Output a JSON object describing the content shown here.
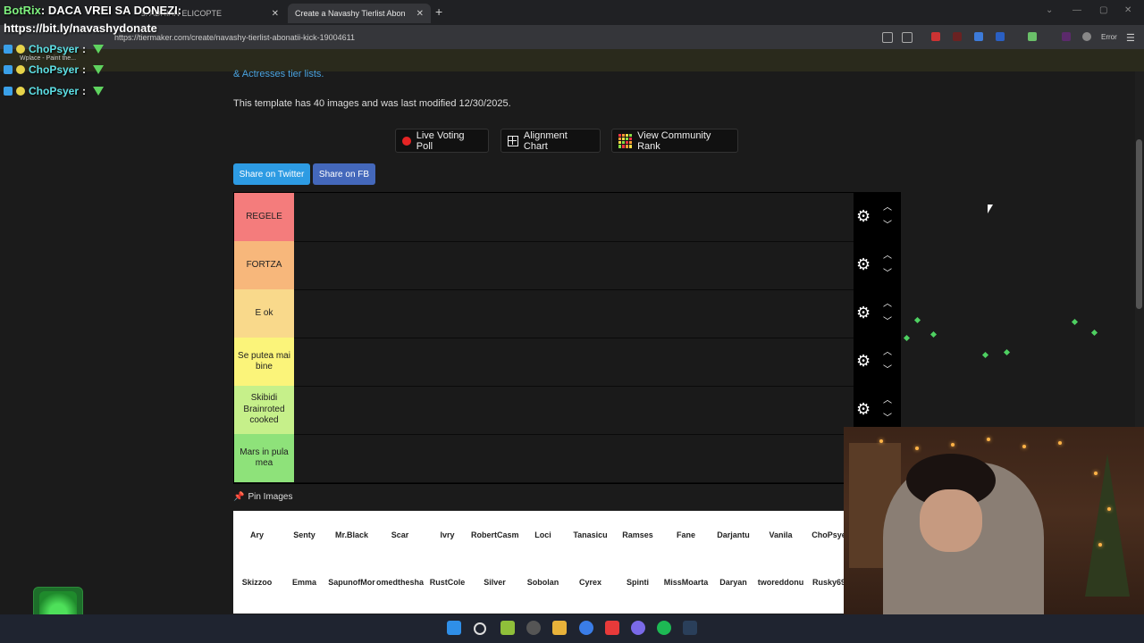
{
  "browser": {
    "tab1_title": "s. ADRIAN ELICOPTE",
    "tab2_title": "Create a Navashy Tierlist Abon",
    "url": "https://tiermaker.com/create/navashy-tierlist-abonatii-kick-19004611",
    "error_label": "Error"
  },
  "overlay": {
    "bot_name": "BotRix",
    "donate_text": ": DACA VREI SA DONEZI:",
    "donate_link": "https://bit.ly/navashydonate",
    "wplace_text": "Wplace - Paint the...",
    "chat": [
      {
        "user": "ChoPsyer",
        "sep": ":"
      },
      {
        "user": "ChoPsyer",
        "sep": ":"
      },
      {
        "user": "ChoPsyer",
        "sep": ":"
      }
    ]
  },
  "page": {
    "tierlists_link": "& Actresses tier lists.",
    "template_info": "This template has 40 images and was last modified 12/30/2025.",
    "buttons": {
      "live_voting": "Live Voting Poll",
      "alignment": "Alignment Chart",
      "community_rank": "View Community Rank"
    },
    "share_twitter": "Share on Twitter",
    "share_fb": "Share on FB",
    "pin_images": "Pin Images"
  },
  "tiers": [
    {
      "label": "REGELE",
      "color": "#f47c7c"
    },
    {
      "label": "FORTZA",
      "color": "#f7b77b"
    },
    {
      "label": "E ok",
      "color": "#f9d98b"
    },
    {
      "label": "Se putea mai bine",
      "color": "#fbf47a"
    },
    {
      "label": "Skibidi Brainroted cooked",
      "color": "#c6f08a"
    },
    {
      "label": "Mars in pula mea",
      "color": "#8ee27a"
    }
  ],
  "pool_row1": [
    "Ary",
    "Senty",
    "Mr.Black",
    "Scar",
    "Ivry",
    "RobertCasm",
    "Loci",
    "Tanasicu",
    "Ramses",
    "Fane",
    "Darjantu",
    "Vanila",
    "ChoPsye"
  ],
  "pool_row2": [
    "Skizzoo",
    "Emma",
    "SapunofMor",
    "omedthesha",
    "RustCole",
    "Silver",
    "Sobolan",
    "Cyrex",
    "Spinti",
    "MissMoarta",
    "Daryan",
    "tworeddonu",
    "Rusky69"
  ],
  "colors": {
    "twitter": "#2d9be3",
    "facebook": "#4468bb",
    "accent_link": "#4aa3df"
  }
}
